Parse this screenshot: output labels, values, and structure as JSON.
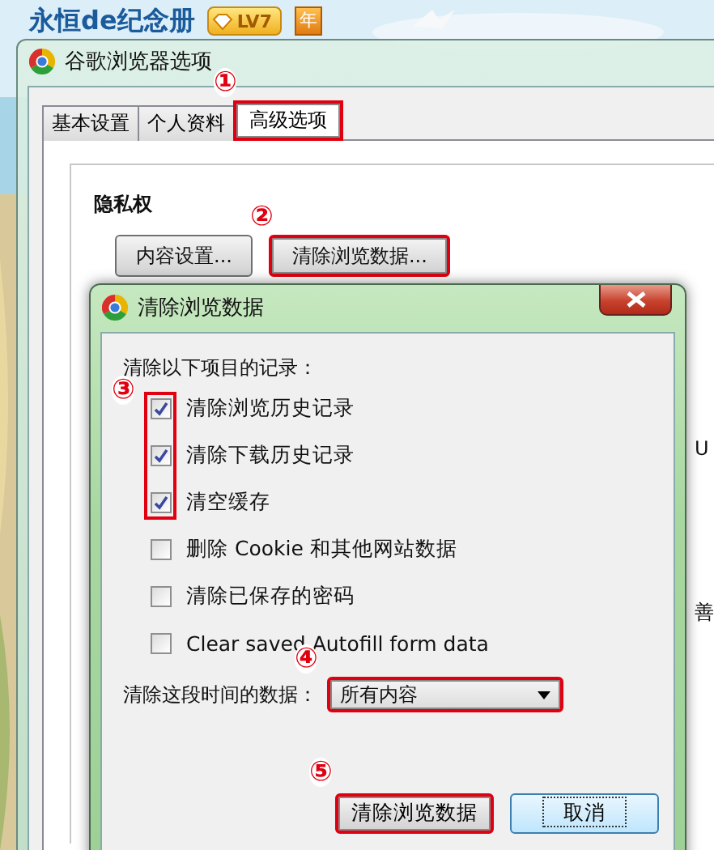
{
  "profile": {
    "name": "永恒de纪念册",
    "level_badge": "LV7",
    "year_badge": "年"
  },
  "window": {
    "title": "谷歌浏览器选项"
  },
  "tabs": [
    {
      "label": "基本设置",
      "selected": false,
      "highlighted": false
    },
    {
      "label": "个人资料",
      "selected": false,
      "highlighted": false
    },
    {
      "label": "高级选项",
      "selected": true,
      "highlighted": true,
      "step": "①"
    }
  ],
  "section": {
    "title": "隐私权",
    "buttons": [
      {
        "label": "内容设置...",
        "highlighted": false
      },
      {
        "label": "清除浏览数据...",
        "highlighted": true,
        "step": "②"
      }
    ]
  },
  "background_fragments": [
    "U",
    "善"
  ],
  "dialog": {
    "title": "清除浏览数据",
    "prompt": "清除以下项目的记录：",
    "items_step": "③",
    "items": [
      {
        "label": "清除浏览历史记录",
        "checked": true,
        "highlighted": true
      },
      {
        "label": "清除下载历史记录",
        "checked": true,
        "highlighted": true
      },
      {
        "label": "清空缓存",
        "checked": true,
        "highlighted": true
      },
      {
        "label": "删除 Cookie 和其他网站数据",
        "checked": false,
        "highlighted": false
      },
      {
        "label": "清除已保存的密码",
        "checked": false,
        "highlighted": false
      },
      {
        "label": "Clear saved Autofill form data",
        "checked": false,
        "highlighted": false
      }
    ],
    "range": {
      "label": "清除这段时间的数据：",
      "value": "所有内容",
      "highlighted": true,
      "step": "④"
    },
    "buttons": [
      {
        "label": "清除浏览数据",
        "focused": false,
        "highlighted": true,
        "step": "⑤"
      },
      {
        "label": "取消",
        "focused": true,
        "highlighted": false
      }
    ]
  }
}
